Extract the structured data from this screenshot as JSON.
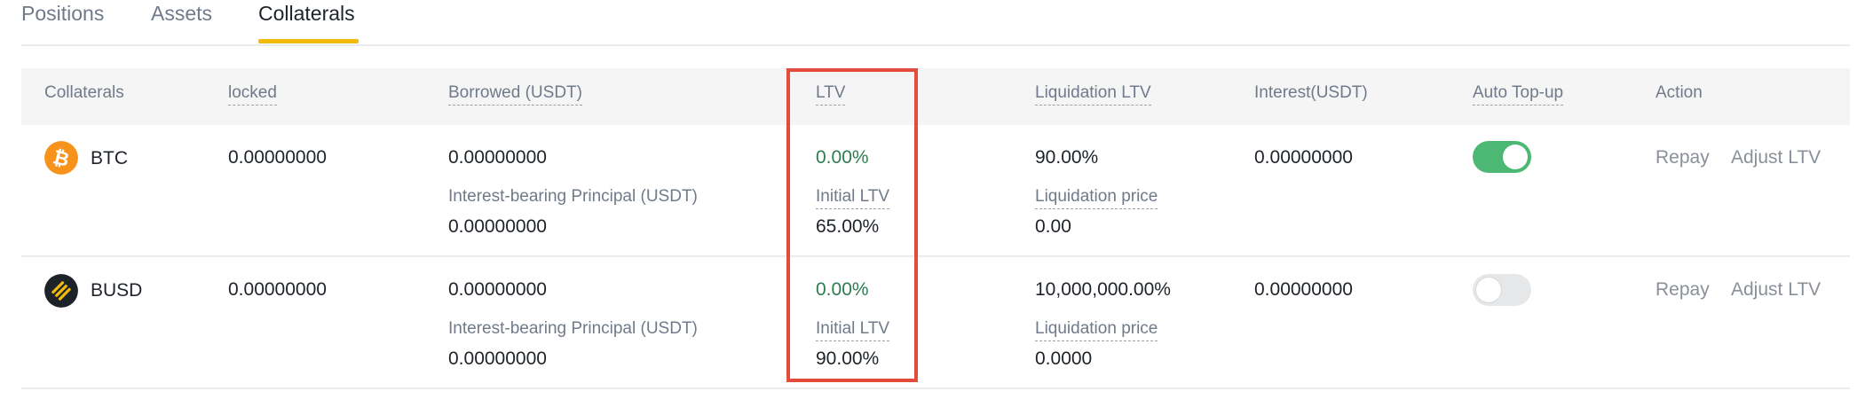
{
  "tabs": [
    {
      "label": "Positions"
    },
    {
      "label": "Assets"
    },
    {
      "label": "Collaterals"
    }
  ],
  "table": {
    "headers": [
      "Collaterals",
      "locked",
      "Borrowed (USDT)",
      "LTV",
      "Liquidation LTV",
      "Interest(USDT)",
      "Auto Top-up",
      "Action"
    ],
    "rows": [
      {
        "coin": "BTC",
        "icon": "bitcoin-icon",
        "locked": "0.00000000",
        "borrowed": "0.00000000",
        "principal_label": "Interest-bearing Principal (USDT)",
        "principal": "0.00000000",
        "ltv": "0.00%",
        "initial_ltv_label": "Initial LTV",
        "initial_ltv": "65.00%",
        "liquidation_ltv": "90.00%",
        "liquidation_price_label": "Liquidation price",
        "liquidation_price": "0.00",
        "interest": "0.00000000",
        "auto_topup": true,
        "repay": "Repay",
        "adjust": "Adjust LTV"
      },
      {
        "coin": "BUSD",
        "icon": "busd-icon",
        "locked": "0.00000000",
        "borrowed": "0.00000000",
        "principal_label": "Interest-bearing Principal (USDT)",
        "principal": "0.00000000",
        "ltv": "0.00%",
        "initial_ltv_label": "Initial LTV",
        "initial_ltv": "90.00%",
        "liquidation_ltv": "10,000,000.00%",
        "liquidation_price_label": "Liquidation price",
        "liquidation_price": "0.0000",
        "interest": "0.00000000",
        "auto_topup": false,
        "repay": "Repay",
        "adjust": "Adjust LTV"
      }
    ]
  },
  "colors": {
    "accent": "#f0b90b",
    "positive": "#2e7d4f",
    "toggle_on": "#4cb873",
    "highlight": "#e34b3a"
  }
}
